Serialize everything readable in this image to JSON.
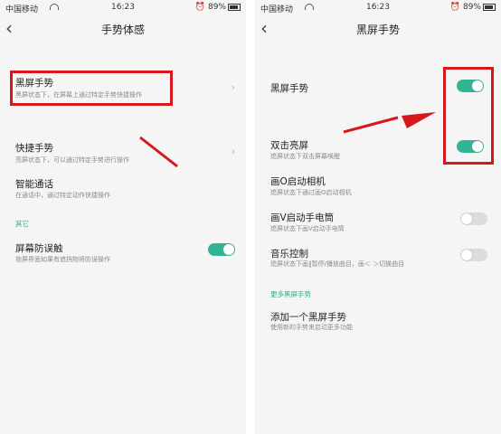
{
  "left": {
    "status": {
      "carrier": "中国移动",
      "time": "16:23",
      "battery": "89%"
    },
    "nav": {
      "title": "手势体感",
      "back_glyph": "‹"
    },
    "items": [
      {
        "title": "黑屏手势",
        "subtitle": "黑屏状态下，在屏幕上通过特定手势快捷操作"
      },
      {
        "title": "快捷手势",
        "subtitle": "亮屏状态下，可以通过特定手势进行操作"
      },
      {
        "title": "智能通话",
        "subtitle": "在通话中，通过特定动作快捷操作"
      }
    ],
    "section": "其它",
    "other_item": {
      "title": "屏幕防误触",
      "subtitle": "锁屏界面如果有遮挡物将防误操作",
      "enabled": true
    }
  },
  "right": {
    "status": {
      "carrier": "中国移动",
      "time": "16:23",
      "battery": "89%"
    },
    "nav": {
      "title": "黑屏手势",
      "back_glyph": "‹"
    },
    "items": [
      {
        "title": "黑屏手势",
        "subtitle": "",
        "enabled": true
      },
      {
        "title": "双击亮屏",
        "subtitle": "熄屏状态下双击屏幕唤醒",
        "enabled": true
      },
      {
        "title": "画O启动相机",
        "subtitle": "熄屏状态下通过画O启动相机",
        "enabled": null
      },
      {
        "title": "画V启动手电筒",
        "subtitle": "熄屏状态下画V启动手电筒",
        "enabled": false
      },
      {
        "title": "音乐控制",
        "subtitle": "熄屏状态下画‖暂停/播放曲目，画＜ ＞切换曲目",
        "enabled": false
      }
    ],
    "section": "更多黑屏手势",
    "add_item": {
      "title": "添加一个黑屏手势",
      "subtitle": "使用新的手势来启动更多功能"
    }
  },
  "colors": {
    "accent": "#32b596",
    "highlight": "#d6171c",
    "section": "#3fa58c"
  }
}
